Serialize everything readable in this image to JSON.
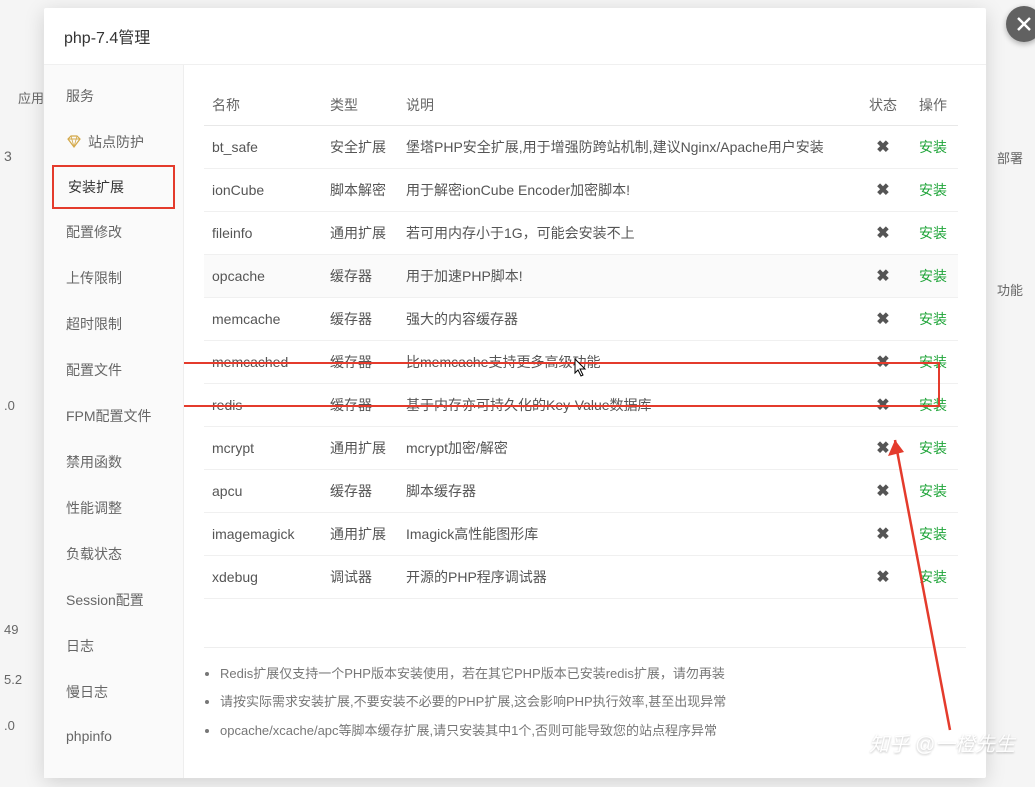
{
  "dialog": {
    "title": "php-7.4管理"
  },
  "sidebar": {
    "items": [
      {
        "label": "服务",
        "icon": ""
      },
      {
        "label": "站点防护",
        "icon": "diamond"
      },
      {
        "label": "安装扩展",
        "icon": "",
        "active": true
      },
      {
        "label": "配置修改",
        "icon": ""
      },
      {
        "label": "上传限制",
        "icon": ""
      },
      {
        "label": "超时限制",
        "icon": ""
      },
      {
        "label": "配置文件",
        "icon": ""
      },
      {
        "label": "FPM配置文件",
        "icon": ""
      },
      {
        "label": "禁用函数",
        "icon": ""
      },
      {
        "label": "性能调整",
        "icon": ""
      },
      {
        "label": "负载状态",
        "icon": ""
      },
      {
        "label": "Session配置",
        "icon": ""
      },
      {
        "label": "日志",
        "icon": ""
      },
      {
        "label": "慢日志",
        "icon": ""
      },
      {
        "label": "phpinfo",
        "icon": ""
      }
    ]
  },
  "table": {
    "headers": {
      "name": "名称",
      "type": "类型",
      "desc": "说明",
      "status": "状态",
      "action": "操作"
    },
    "rows": [
      {
        "name": "bt_safe",
        "type": "安全扩展",
        "desc": "堡塔PHP安全扩展,用于增强防跨站机制,建议Nginx/Apache用户安装",
        "action": "安装"
      },
      {
        "name": "ionCube",
        "type": "脚本解密",
        "desc": "用于解密ionCube Encoder加密脚本!",
        "action": "安装"
      },
      {
        "name": "fileinfo",
        "type": "通用扩展",
        "desc": "若可用内存小于1G，可能会安装不上",
        "action": "安装"
      },
      {
        "name": "opcache",
        "type": "缓存器",
        "desc": "用于加速PHP脚本!",
        "action": "安装",
        "hover": true
      },
      {
        "name": "memcache",
        "type": "缓存器",
        "desc": "强大的内容缓存器",
        "action": "安装"
      },
      {
        "name": "memcached",
        "type": "缓存器",
        "desc": "比memcache支持更多高级功能",
        "action": "安装"
      },
      {
        "name": "redis",
        "type": "缓存器",
        "desc": "基于内存亦可持久化的Key-Value数据库",
        "action": "安装",
        "highlight": true
      },
      {
        "name": "mcrypt",
        "type": "通用扩展",
        "desc": "mcrypt加密/解密",
        "action": "安装"
      },
      {
        "name": "apcu",
        "type": "缓存器",
        "desc": "脚本缓存器",
        "action": "安装"
      },
      {
        "name": "imagemagick",
        "type": "通用扩展",
        "desc": "Imagick高性能图形库",
        "action": "安装"
      },
      {
        "name": "xdebug",
        "type": "调试器",
        "desc": "开源的PHP程序调试器",
        "action": "安装"
      }
    ]
  },
  "notes": [
    "Redis扩展仅支持一个PHP版本安装使用，若在其它PHP版本已安装redis扩展，请勿再装",
    "请按实际需求安装扩展,不要安装不必要的PHP扩展,这会影响PHP执行效率,甚至出现异常",
    "opcache/xcache/apc等脚本缓存扩展,请只安装其中1个,否则可能导致您的站点程序异常"
  ],
  "background": {
    "label1": "应用名",
    "val1": "49",
    "val2": "5.2",
    "val3": ".0",
    "val4": ".0",
    "right1": "部署",
    "right2": "功能"
  },
  "watermark": "知乎 @一橙先生"
}
